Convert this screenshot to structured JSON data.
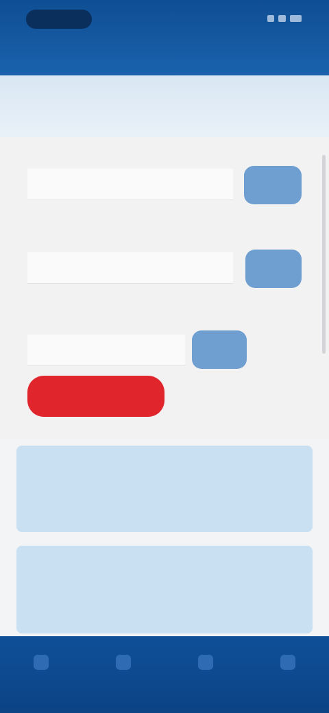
{
  "header": {
    "title": "",
    "status_icons": [
      "signal-icon",
      "wifi-icon",
      "battery-icon"
    ]
  },
  "page": {
    "title": "",
    "link": ""
  },
  "form": {
    "hint": "",
    "rows": [
      {
        "label": "",
        "value": "",
        "button": ""
      },
      {
        "label": "",
        "value": "",
        "button": ""
      },
      {
        "label": "",
        "value": "",
        "button": ""
      }
    ],
    "third_row_side": "",
    "danger_button": "",
    "danger_note": ""
  },
  "cards": [
    {
      "line1_pre": "",
      "line1_highlight": "",
      "line2": "",
      "line3": ""
    },
    {
      "line1_pre": "",
      "line1_highlight": "",
      "line2": "",
      "line3": ""
    }
  ],
  "bottom_nav": [
    {
      "icon": "home-icon",
      "label": ""
    },
    {
      "icon": "list-icon",
      "label": ""
    },
    {
      "icon": "chart-icon",
      "label": ""
    },
    {
      "icon": "user-icon",
      "label": ""
    }
  ],
  "colors": {
    "header": "#1a5ba3",
    "primary_button": "#6f9ed1",
    "danger_button": "#e0252d",
    "card": "#c9e0f2",
    "highlight_text": "#e0303a"
  }
}
